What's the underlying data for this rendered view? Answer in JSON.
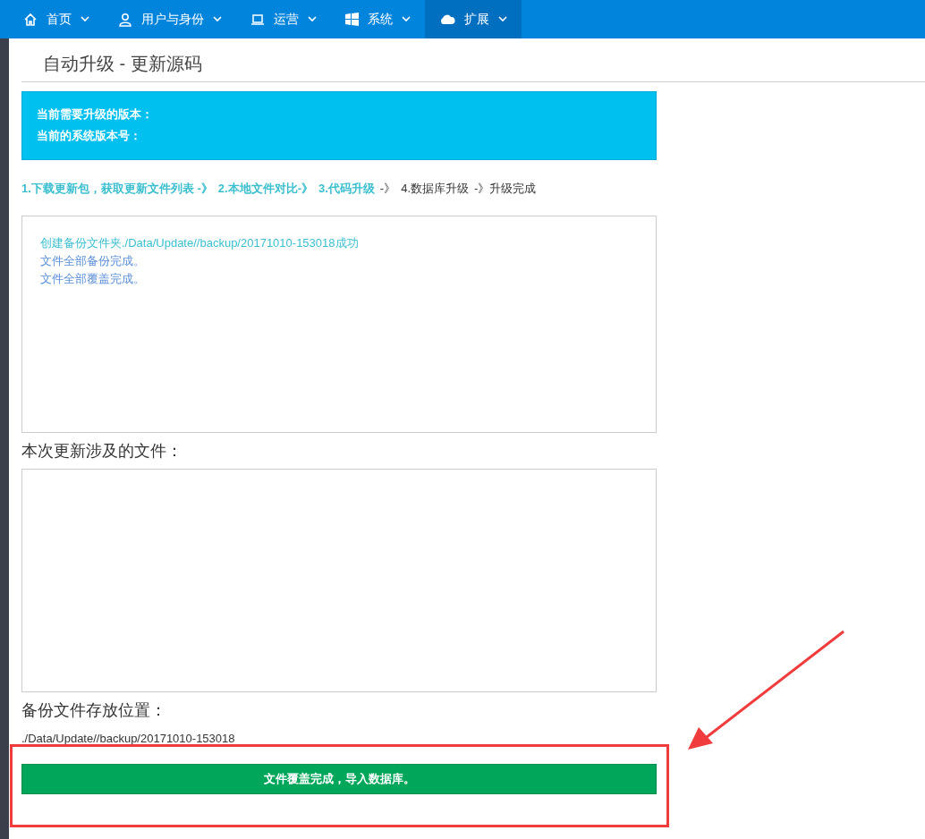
{
  "nav": [
    {
      "label": "首页",
      "kind": "home",
      "selected": false
    },
    {
      "label": "用户与身份",
      "kind": "user",
      "selected": false
    },
    {
      "label": "运营",
      "kind": "laptop",
      "selected": false
    },
    {
      "label": "系统",
      "kind": "windows",
      "selected": false
    },
    {
      "label": "扩展",
      "kind": "cloud",
      "selected": true
    }
  ],
  "page_title": "自动升级 - 更新源码",
  "info": [
    "当前需要升级的版本：",
    "当前的系统版本号："
  ],
  "steps": [
    {
      "label": "1.下载更新包，获取更新文件列表 -》",
      "done": true
    },
    {
      "label": "2.本地文件对比-》",
      "done": true
    },
    {
      "label": "3.代码升级",
      "done": true
    },
    {
      "label": "-》",
      "done": false
    },
    {
      "label": "4.数据库升级",
      "done": false
    },
    {
      "label": "-》升级完成",
      "done": false
    }
  ],
  "log": [
    {
      "text": "创建备份文件夹./Data/Update//backup/20171010-153018成功",
      "color": "#3bbfcf"
    },
    {
      "text": "文件全部备份完成。",
      "color": "#5b8fd8"
    },
    {
      "text": "文件全部覆盖完成。",
      "color": "#5b8fd8"
    }
  ],
  "files_heading": "本次更新涉及的文件：",
  "backup_heading": "备份文件存放位置：",
  "backup_path": "./Data/Update//backup/20171010-153018",
  "action_button": "文件覆盖完成，导入数据库。"
}
